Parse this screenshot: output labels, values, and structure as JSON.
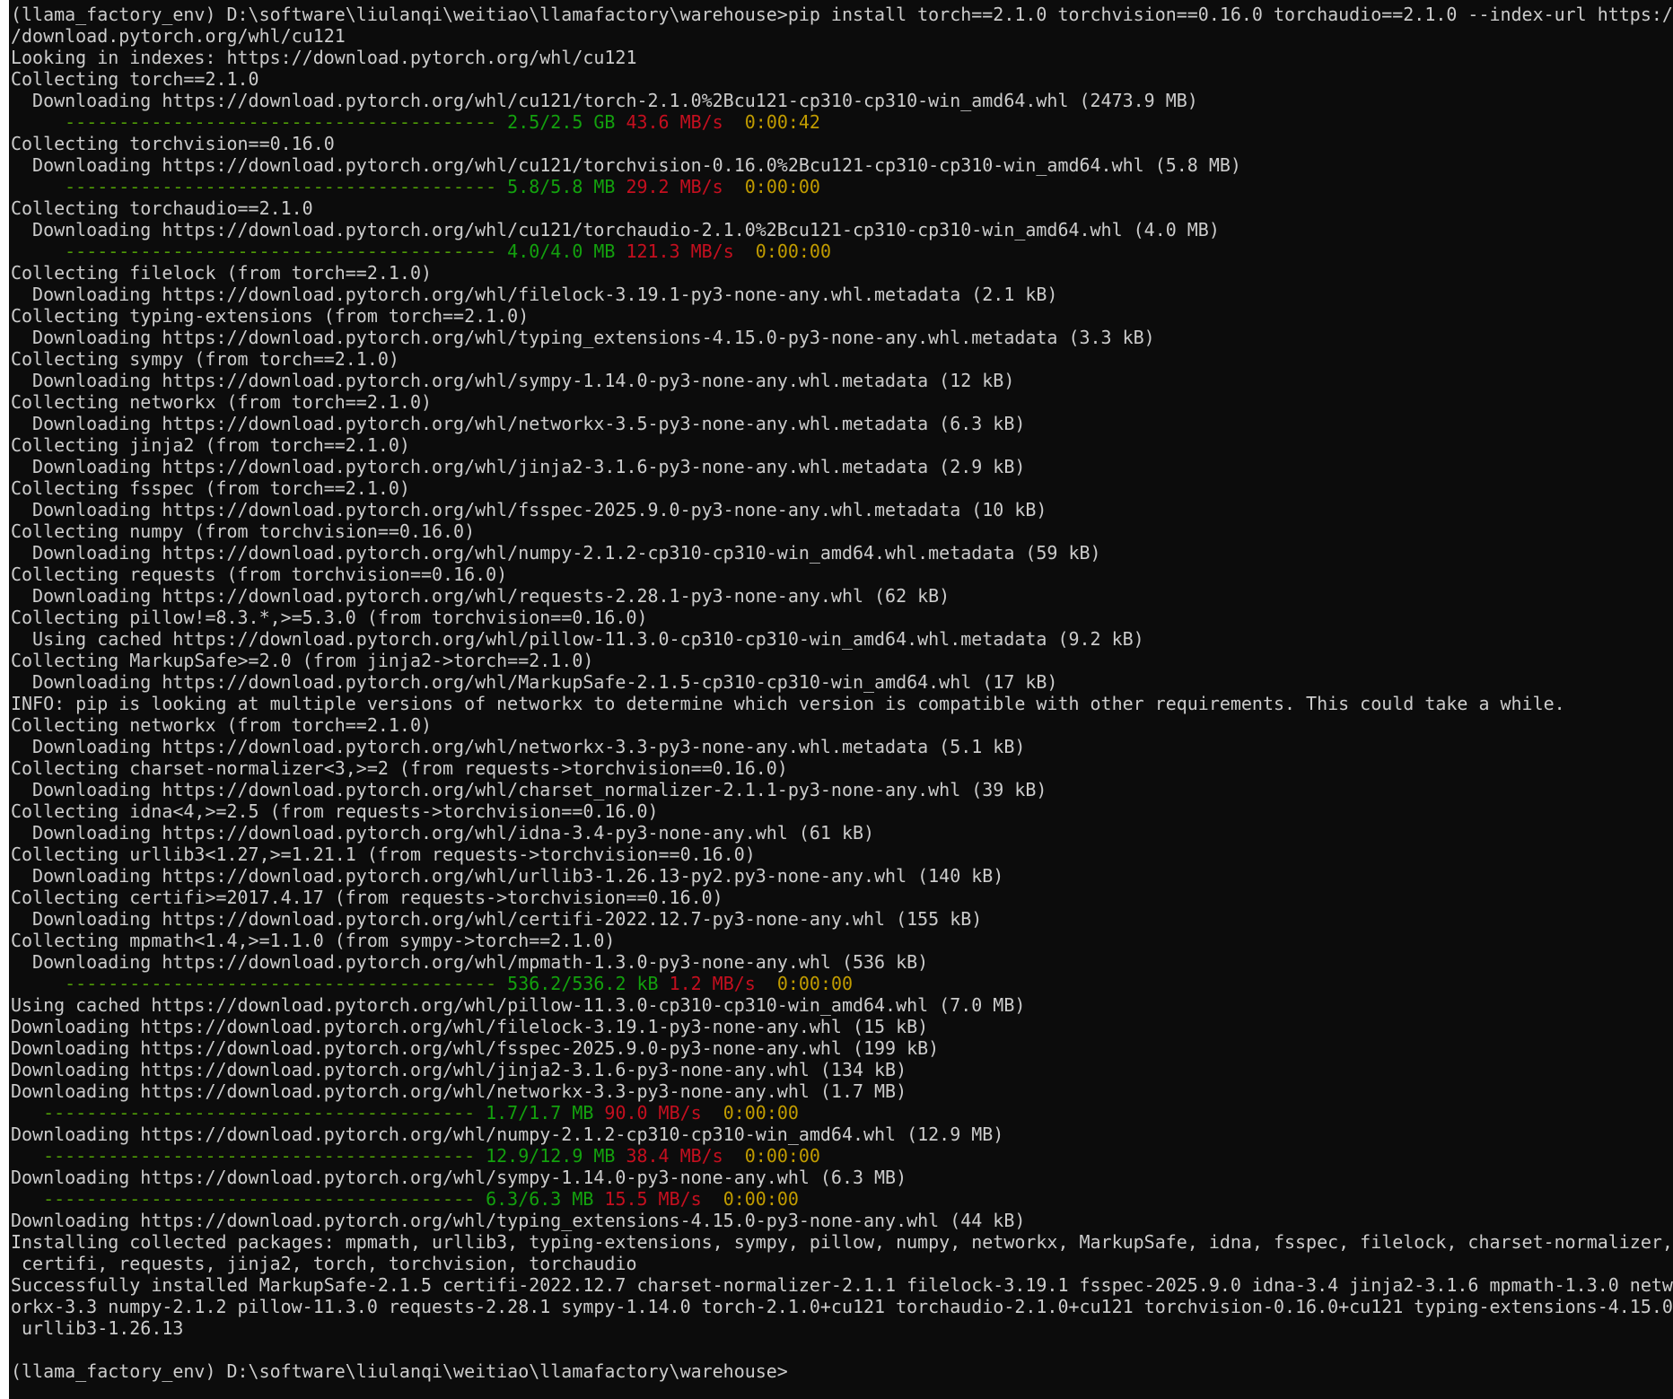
{
  "window": {
    "type": "command-prompt",
    "background": "#0c0c0c",
    "text_color": "#cccccc"
  },
  "colors": {
    "progress_done": "#13a10e",
    "progress_rate": "#c50f1f",
    "progress_eta": "#c19c00",
    "progress_bar": "#4e9a06"
  },
  "lines": [
    {
      "kind": "text",
      "text": "(llama_factory_env) D:\\software\\liulanqi\\weitiao\\llamafactory\\warehouse>pip install torch==2.1.0 torchvision==0.16.0 torchaudio==2.1.0 --index-url https:/"
    },
    {
      "kind": "text",
      "text": "/download.pytorch.org/whl/cu121"
    },
    {
      "kind": "text",
      "text": "Looking in indexes: https://download.pytorch.org/whl/cu121"
    },
    {
      "kind": "text",
      "text": "Collecting torch==2.1.0"
    },
    {
      "kind": "text",
      "text": "  Downloading https://download.pytorch.org/whl/cu121/torch-2.1.0%2Bcu121-cp310-cp310-win_amd64.whl (2473.9 MB)"
    },
    {
      "kind": "progress",
      "indent": "     ",
      "bar": "----------------------------------------",
      "done": "2.5/2.5 GB",
      "rate": "43.6 MB/s",
      "eta": "0:00:42"
    },
    {
      "kind": "text",
      "text": "Collecting torchvision==0.16.0"
    },
    {
      "kind": "text",
      "text": "  Downloading https://download.pytorch.org/whl/cu121/torchvision-0.16.0%2Bcu121-cp310-cp310-win_amd64.whl (5.8 MB)"
    },
    {
      "kind": "progress",
      "indent": "     ",
      "bar": "----------------------------------------",
      "done": "5.8/5.8 MB",
      "rate": "29.2 MB/s",
      "eta": "0:00:00"
    },
    {
      "kind": "text",
      "text": "Collecting torchaudio==2.1.0"
    },
    {
      "kind": "text",
      "text": "  Downloading https://download.pytorch.org/whl/cu121/torchaudio-2.1.0%2Bcu121-cp310-cp310-win_amd64.whl (4.0 MB)"
    },
    {
      "kind": "progress",
      "indent": "     ",
      "bar": "----------------------------------------",
      "done": "4.0/4.0 MB",
      "rate": "121.3 MB/s",
      "eta": "0:00:00"
    },
    {
      "kind": "text",
      "text": "Collecting filelock (from torch==2.1.0)"
    },
    {
      "kind": "text",
      "text": "  Downloading https://download.pytorch.org/whl/filelock-3.19.1-py3-none-any.whl.metadata (2.1 kB)"
    },
    {
      "kind": "text",
      "text": "Collecting typing-extensions (from torch==2.1.0)"
    },
    {
      "kind": "text",
      "text": "  Downloading https://download.pytorch.org/whl/typing_extensions-4.15.0-py3-none-any.whl.metadata (3.3 kB)"
    },
    {
      "kind": "text",
      "text": "Collecting sympy (from torch==2.1.0)"
    },
    {
      "kind": "text",
      "text": "  Downloading https://download.pytorch.org/whl/sympy-1.14.0-py3-none-any.whl.metadata (12 kB)"
    },
    {
      "kind": "text",
      "text": "Collecting networkx (from torch==2.1.0)"
    },
    {
      "kind": "text",
      "text": "  Downloading https://download.pytorch.org/whl/networkx-3.5-py3-none-any.whl.metadata (6.3 kB)"
    },
    {
      "kind": "text",
      "text": "Collecting jinja2 (from torch==2.1.0)"
    },
    {
      "kind": "text",
      "text": "  Downloading https://download.pytorch.org/whl/jinja2-3.1.6-py3-none-any.whl.metadata (2.9 kB)"
    },
    {
      "kind": "text",
      "text": "Collecting fsspec (from torch==2.1.0)"
    },
    {
      "kind": "text",
      "text": "  Downloading https://download.pytorch.org/whl/fsspec-2025.9.0-py3-none-any.whl.metadata (10 kB)"
    },
    {
      "kind": "text",
      "text": "Collecting numpy (from torchvision==0.16.0)"
    },
    {
      "kind": "text",
      "text": "  Downloading https://download.pytorch.org/whl/numpy-2.1.2-cp310-cp310-win_amd64.whl.metadata (59 kB)"
    },
    {
      "kind": "text",
      "text": "Collecting requests (from torchvision==0.16.0)"
    },
    {
      "kind": "text",
      "text": "  Downloading https://download.pytorch.org/whl/requests-2.28.1-py3-none-any.whl (62 kB)"
    },
    {
      "kind": "text",
      "text": "Collecting pillow!=8.3.*,>=5.3.0 (from torchvision==0.16.0)"
    },
    {
      "kind": "text",
      "text": "  Using cached https://download.pytorch.org/whl/pillow-11.3.0-cp310-cp310-win_amd64.whl.metadata (9.2 kB)"
    },
    {
      "kind": "text",
      "text": "Collecting MarkupSafe>=2.0 (from jinja2->torch==2.1.0)"
    },
    {
      "kind": "text",
      "text": "  Downloading https://download.pytorch.org/whl/MarkupSafe-2.1.5-cp310-cp310-win_amd64.whl (17 kB)"
    },
    {
      "kind": "text",
      "text": "INFO: pip is looking at multiple versions of networkx to determine which version is compatible with other requirements. This could take a while."
    },
    {
      "kind": "text",
      "text": "Collecting networkx (from torch==2.1.0)"
    },
    {
      "kind": "text",
      "text": "  Downloading https://download.pytorch.org/whl/networkx-3.3-py3-none-any.whl.metadata (5.1 kB)"
    },
    {
      "kind": "text",
      "text": "Collecting charset-normalizer<3,>=2 (from requests->torchvision==0.16.0)"
    },
    {
      "kind": "text",
      "text": "  Downloading https://download.pytorch.org/whl/charset_normalizer-2.1.1-py3-none-any.whl (39 kB)"
    },
    {
      "kind": "text",
      "text": "Collecting idna<4,>=2.5 (from requests->torchvision==0.16.0)"
    },
    {
      "kind": "text",
      "text": "  Downloading https://download.pytorch.org/whl/idna-3.4-py3-none-any.whl (61 kB)"
    },
    {
      "kind": "text",
      "text": "Collecting urllib3<1.27,>=1.21.1 (from requests->torchvision==0.16.0)"
    },
    {
      "kind": "text",
      "text": "  Downloading https://download.pytorch.org/whl/urllib3-1.26.13-py2.py3-none-any.whl (140 kB)"
    },
    {
      "kind": "text",
      "text": "Collecting certifi>=2017.4.17 (from requests->torchvision==0.16.0)"
    },
    {
      "kind": "text",
      "text": "  Downloading https://download.pytorch.org/whl/certifi-2022.12.7-py3-none-any.whl (155 kB)"
    },
    {
      "kind": "text",
      "text": "Collecting mpmath<1.4,>=1.1.0 (from sympy->torch==2.1.0)"
    },
    {
      "kind": "text",
      "text": "  Downloading https://download.pytorch.org/whl/mpmath-1.3.0-py3-none-any.whl (536 kB)"
    },
    {
      "kind": "progress",
      "indent": "     ",
      "bar": "----------------------------------------",
      "done": "536.2/536.2 kB",
      "rate": "1.2 MB/s",
      "eta": "0:00:00"
    },
    {
      "kind": "text",
      "text": "Using cached https://download.pytorch.org/whl/pillow-11.3.0-cp310-cp310-win_amd64.whl (7.0 MB)"
    },
    {
      "kind": "text",
      "text": "Downloading https://download.pytorch.org/whl/filelock-3.19.1-py3-none-any.whl (15 kB)"
    },
    {
      "kind": "text",
      "text": "Downloading https://download.pytorch.org/whl/fsspec-2025.9.0-py3-none-any.whl (199 kB)"
    },
    {
      "kind": "text",
      "text": "Downloading https://download.pytorch.org/whl/jinja2-3.1.6-py3-none-any.whl (134 kB)"
    },
    {
      "kind": "text",
      "text": "Downloading https://download.pytorch.org/whl/networkx-3.3-py3-none-any.whl (1.7 MB)"
    },
    {
      "kind": "progress",
      "indent": "   ",
      "bar": "----------------------------------------",
      "done": "1.7/1.7 MB",
      "rate": "90.0 MB/s",
      "eta": "0:00:00"
    },
    {
      "kind": "text",
      "text": "Downloading https://download.pytorch.org/whl/numpy-2.1.2-cp310-cp310-win_amd64.whl (12.9 MB)"
    },
    {
      "kind": "progress",
      "indent": "   ",
      "bar": "----------------------------------------",
      "done": "12.9/12.9 MB",
      "rate": "38.4 MB/s",
      "eta": "0:00:00"
    },
    {
      "kind": "text",
      "text": "Downloading https://download.pytorch.org/whl/sympy-1.14.0-py3-none-any.whl (6.3 MB)"
    },
    {
      "kind": "progress",
      "indent": "   ",
      "bar": "----------------------------------------",
      "done": "6.3/6.3 MB",
      "rate": "15.5 MB/s",
      "eta": "0:00:00"
    },
    {
      "kind": "text",
      "text": "Downloading https://download.pytorch.org/whl/typing_extensions-4.15.0-py3-none-any.whl (44 kB)"
    },
    {
      "kind": "text",
      "text": "Installing collected packages: mpmath, urllib3, typing-extensions, sympy, pillow, numpy, networkx, MarkupSafe, idna, fsspec, filelock, charset-normalizer,"
    },
    {
      "kind": "text",
      "text": " certifi, requests, jinja2, torch, torchvision, torchaudio"
    },
    {
      "kind": "text",
      "text": "Successfully installed MarkupSafe-2.1.5 certifi-2022.12.7 charset-normalizer-2.1.1 filelock-3.19.1 fsspec-2025.9.0 idna-3.4 jinja2-3.1.6 mpmath-1.3.0 netw"
    },
    {
      "kind": "text",
      "text": "orkx-3.3 numpy-2.1.2 pillow-11.3.0 requests-2.28.1 sympy-1.14.0 torch-2.1.0+cu121 torchaudio-2.1.0+cu121 torchvision-0.16.0+cu121 typing-extensions-4.15.0"
    },
    {
      "kind": "text",
      "text": " urllib3-1.26.13"
    },
    {
      "kind": "text",
      "text": ""
    },
    {
      "kind": "prompt",
      "text": "(llama_factory_env) D:\\software\\liulanqi\\weitiao\\llamafactory\\warehouse>"
    }
  ]
}
